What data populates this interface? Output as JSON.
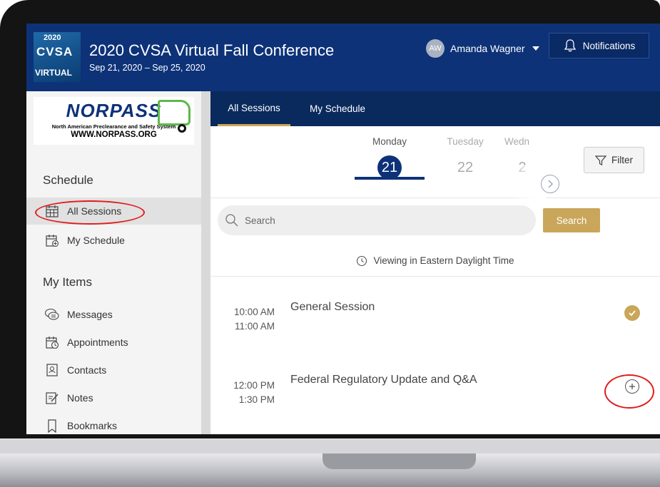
{
  "header": {
    "logo": {
      "year": "2020",
      "name": "CVSA",
      "subtitle": "VIRTUAL"
    },
    "title": "2020 CVSA Virtual Fall Conference",
    "dates": "Sep 21, 2020 – Sep 25, 2020",
    "user": {
      "initials": "AW",
      "name": "Amanda Wagner"
    },
    "notifications_label": "Notifications"
  },
  "sidebar": {
    "sponsor": {
      "name": "NORPASS",
      "tagline": "North American Preclearance and Safety System",
      "url": "WWW.NORPASS.ORG"
    },
    "schedule_heading": "Schedule",
    "schedule_items": [
      {
        "label": "All Sessions",
        "icon": "calendar-grid-icon",
        "active": true
      },
      {
        "label": "My Schedule",
        "icon": "calendar-add-icon",
        "active": false
      }
    ],
    "my_items_heading": "My Items",
    "my_items": [
      {
        "label": "Messages",
        "icon": "chat-icon"
      },
      {
        "label": "Appointments",
        "icon": "calendar-clock-icon"
      },
      {
        "label": "Contacts",
        "icon": "contact-card-icon"
      },
      {
        "label": "Notes",
        "icon": "note-edit-icon"
      },
      {
        "label": "Bookmarks",
        "icon": "bookmark-icon"
      }
    ]
  },
  "main": {
    "tabs": [
      {
        "label": "All Sessions",
        "active": true
      },
      {
        "label": "My Schedule",
        "active": false
      }
    ],
    "days": [
      {
        "name": "Monday",
        "number": "21",
        "selected": true
      },
      {
        "name": "Tuesday",
        "number": "22",
        "selected": false
      },
      {
        "name": "Wedn",
        "number": "2",
        "selected": false
      }
    ],
    "filter_label": "Filter",
    "search": {
      "placeholder": "Search",
      "value": "",
      "button_label": "Search"
    },
    "timezone_note": "Viewing in Eastern Daylight Time",
    "sessions": [
      {
        "start": "10:00 AM",
        "end": "11:00 AM",
        "title": "General Session",
        "in_schedule": true
      },
      {
        "start": "12:00 PM",
        "end": "1:30 PM",
        "title": "Federal Regulatory Update and Q&A",
        "in_schedule": false
      }
    ]
  },
  "colors": {
    "header_bg": "#0d3278",
    "tabs_bg": "#0a2a5e",
    "accent_gold": "#c9a65a",
    "annotation_red": "#e11d1d"
  }
}
